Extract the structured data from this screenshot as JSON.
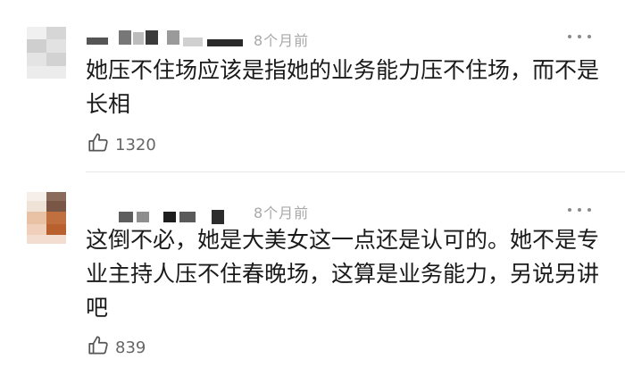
{
  "comments": [
    {
      "time": "8个月前",
      "text": "她压不住场应该是指她的业务能力压不住场，而不是长相",
      "likes": "1320"
    },
    {
      "time": "8个月前",
      "text": "这倒不必，她是大美女这一点还是认可的。她不是专业主持人压不住春晚场，这算是业务能力，另说另讲吧",
      "likes": "839"
    }
  ],
  "icons": {
    "like": "thumbs-up-icon",
    "more": "more-dots-icon"
  }
}
